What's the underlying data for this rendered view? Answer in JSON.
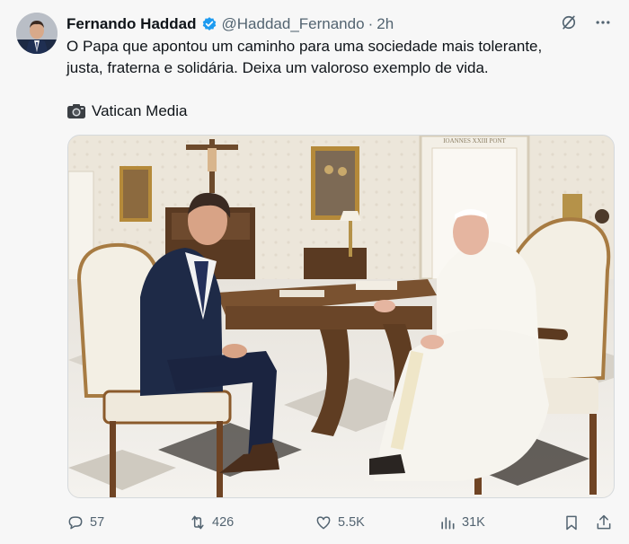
{
  "post": {
    "author_name": "Fernando Haddad",
    "handle": "@Haddad_Fernando",
    "separator": "·",
    "time": "2h",
    "text_line1": "O Papa que apontou um caminho para uma sociedade mais tolerante,",
    "text_line2": "justa, fraterna e solidária. Deixa um valoroso exemplo de vida.",
    "credit": "Vatican Media",
    "photo_inscription": "IOANNES XXIII PONT"
  },
  "actions": {
    "replies": "57",
    "reposts": "426",
    "likes": "5.5K",
    "views": "31K"
  },
  "colors": {
    "verified": "#1d9bf0",
    "secondary_text": "#536471",
    "background": "#f7f7f7"
  },
  "icons": [
    "verified-badge-icon",
    "grok-icon",
    "more-icon",
    "camera-icon",
    "reply-icon",
    "repost-icon",
    "like-icon",
    "views-icon",
    "bookmark-icon",
    "share-icon"
  ]
}
